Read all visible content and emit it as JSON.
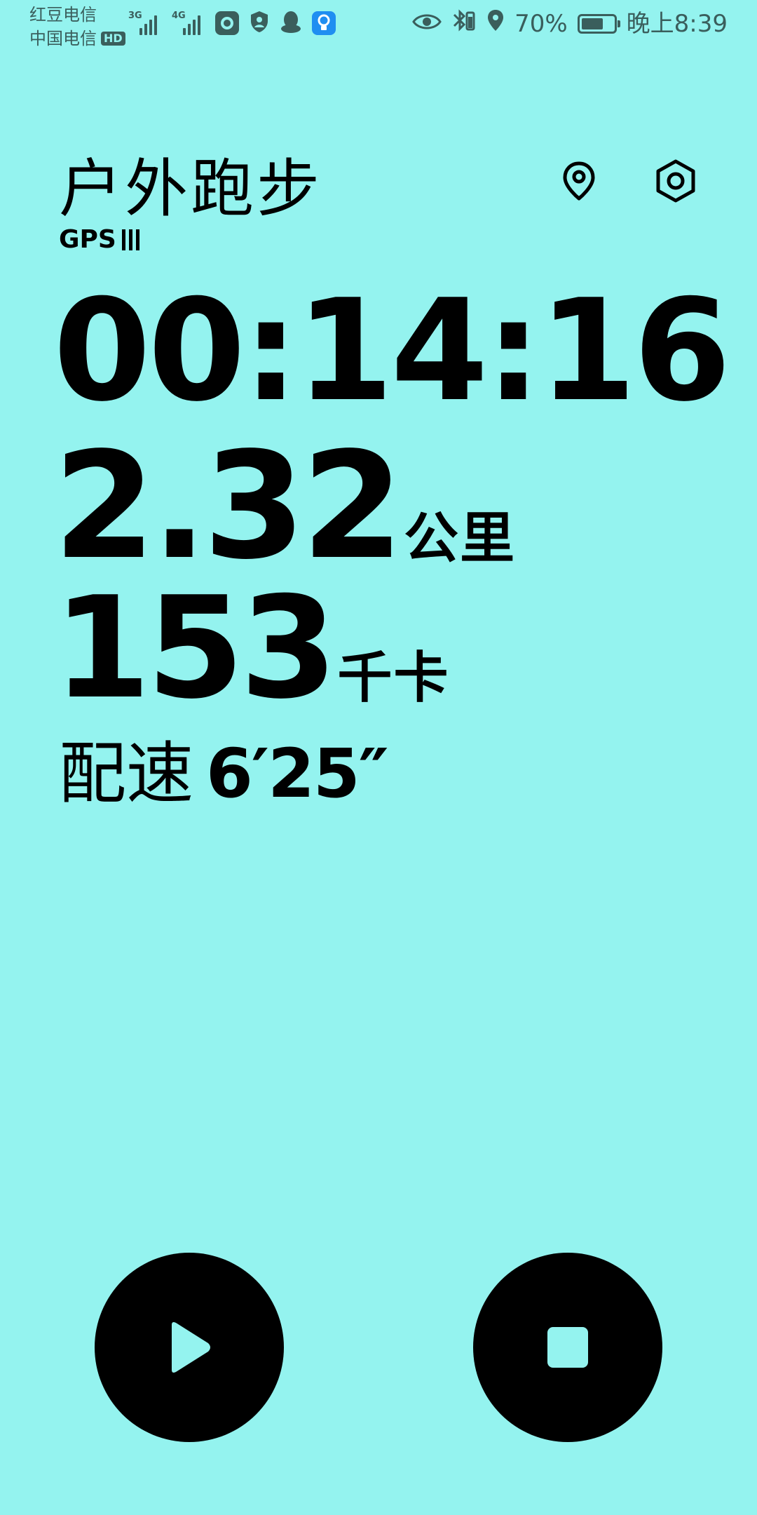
{
  "status_bar": {
    "carrier_1": "红豆电信",
    "carrier_2": "中国电信",
    "hd_badge": "HD",
    "network_1": "3G",
    "network_2": "4G",
    "battery_percent": "70%",
    "battery_level": 0.7,
    "time": "晚上8:39",
    "icons": [
      "signal-3g-icon",
      "signal-4g-icon",
      "app-notification-icon",
      "shield-icon",
      "qq-penguin-icon",
      "lightbulb-icon",
      "eye-icon",
      "bluetooth-icon",
      "location-icon",
      "battery-icon"
    ]
  },
  "header": {
    "title": "户外跑步",
    "gps_label": "GPS",
    "location_icon": "map-pin-icon",
    "settings_icon": "hex-settings-icon"
  },
  "stats": {
    "timer": "00:14:16",
    "distance_value": "2.32",
    "distance_unit": "公里",
    "calories_value": "153",
    "calories_unit": "千卡",
    "pace_label": "配速",
    "pace_value": "6′25″"
  },
  "controls": {
    "play_icon": "play-icon",
    "stop_icon": "stop-icon"
  },
  "colors": {
    "background": "#94f3ef",
    "foreground": "#000000",
    "status_text": "#3a5e5c"
  }
}
